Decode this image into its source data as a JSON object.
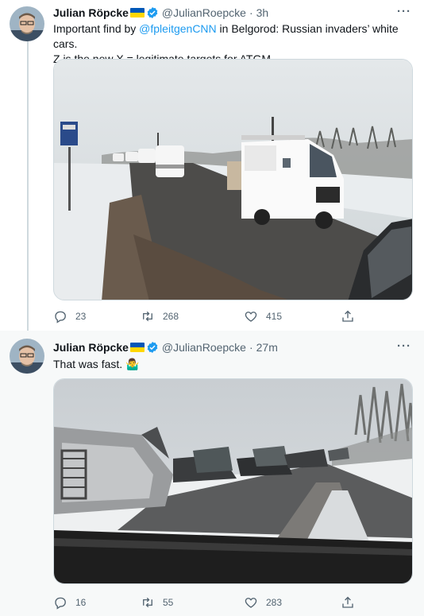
{
  "tweets": [
    {
      "name": "Julian Röpcke",
      "handle": "@JulianRoepcke",
      "time": "3h",
      "text_parts": [
        "Important find by ",
        "@fpleitgenCNN",
        " in Belgorod: Russian invaders’ white cars.",
        "Z is the new X = legitimate targets for ATGM."
      ],
      "replies": "23",
      "retweets": "268",
      "likes": "415"
    },
    {
      "name": "Julian Röpcke",
      "handle": "@JulianRoepcke",
      "time": "27m",
      "text": "That was fast.",
      "emoji": "🤷‍♂️",
      "replies": "16",
      "retweets": "55",
      "likes": "283"
    }
  ],
  "icons": {
    "verified": "verified-badge-icon",
    "flag": "ukraine-flag-icon",
    "more": "more-icon",
    "reply": "reply-icon",
    "retweet": "retweet-icon",
    "like": "like-icon",
    "share": "share-icon"
  },
  "colors": {
    "accent": "#1d9bf0",
    "muted": "#536471",
    "text": "#0f1419",
    "alt_bg": "#f7f9f9"
  },
  "ui": {
    "dot": "·",
    "more_glyph": "···"
  }
}
